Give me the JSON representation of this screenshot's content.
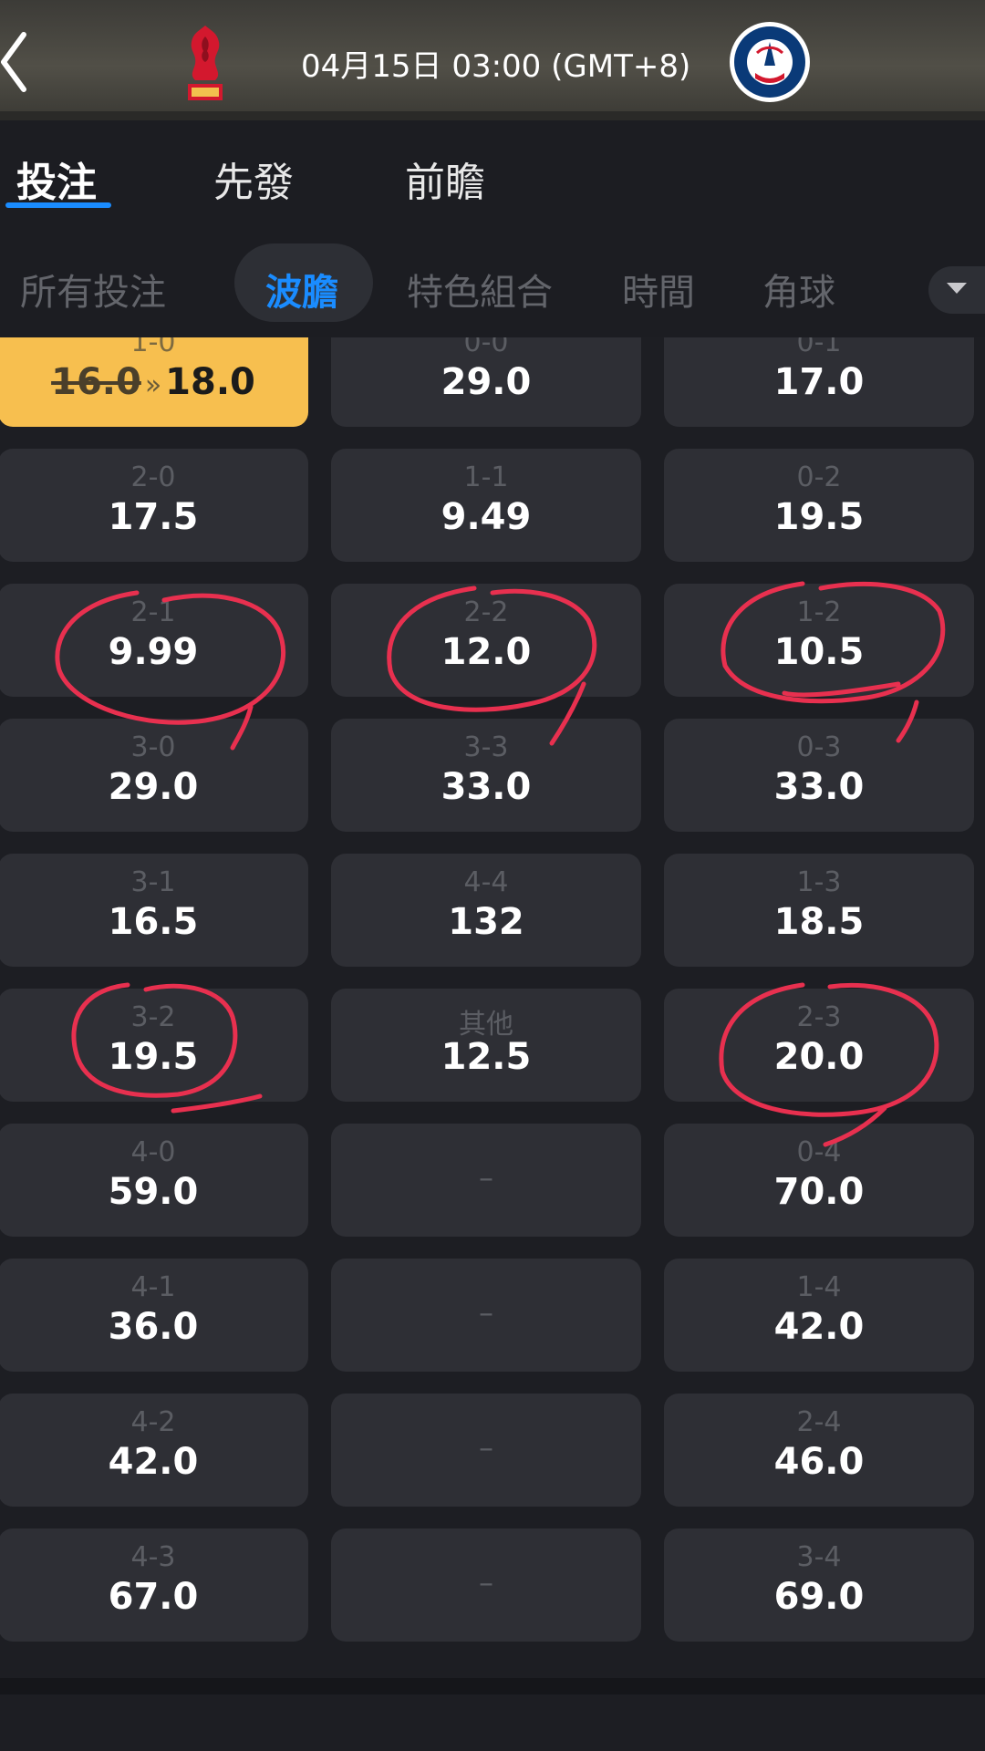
{
  "header": {
    "back_icon": "chevron-left-icon",
    "home_logo": "liverpool-crest",
    "away_logo": "psg-crest",
    "match_time": "04月15日 03:00 (GMT+8)"
  },
  "tabs": [
    {
      "label": "投注",
      "active": true
    },
    {
      "label": "先發",
      "active": false
    },
    {
      "label": "前瞻",
      "active": false
    }
  ],
  "subtabs": [
    {
      "label": "所有投注",
      "active": false
    },
    {
      "label": "波膽",
      "active": true
    },
    {
      "label": "特色組合",
      "active": false
    },
    {
      "label": "時間",
      "active": false
    },
    {
      "label": "角球",
      "active": false
    }
  ],
  "more_icon": "triangle-down-icon",
  "colors": {
    "accent": "#1a8cff",
    "highlight": "#f7bf4f",
    "cell": "#2e2f35",
    "annotation": "#e8304f"
  },
  "odds": {
    "highlighted": {
      "score": "1-0",
      "old_odds": "16.0",
      "arrow": "»",
      "new_odds": "18.0"
    },
    "rows": [
      [
        {
          "score": "2-0",
          "odds": "17.5"
        },
        {
          "score": "1-1",
          "odds": "9.49"
        },
        {
          "score": "0-2",
          "odds": "19.5"
        }
      ],
      [
        {
          "score": "2-1",
          "odds": "9.99"
        },
        {
          "score": "2-2",
          "odds": "12.0"
        },
        {
          "score": "1-2",
          "odds": "10.5"
        }
      ],
      [
        {
          "score": "3-0",
          "odds": "29.0"
        },
        {
          "score": "3-3",
          "odds": "33.0"
        },
        {
          "score": "0-3",
          "odds": "33.0"
        }
      ],
      [
        {
          "score": "3-1",
          "odds": "16.5"
        },
        {
          "score": "4-4",
          "odds": "132"
        },
        {
          "score": "1-3",
          "odds": "18.5"
        }
      ],
      [
        {
          "score": "3-2",
          "odds": "19.5"
        },
        {
          "score": "其他",
          "odds": "12.5"
        },
        {
          "score": "2-3",
          "odds": "20.0"
        }
      ],
      [
        {
          "score": "4-0",
          "odds": "59.0"
        },
        {
          "dash": "–"
        },
        {
          "score": "0-4",
          "odds": "70.0"
        }
      ],
      [
        {
          "score": "4-1",
          "odds": "36.0"
        },
        {
          "dash": "–"
        },
        {
          "score": "1-4",
          "odds": "42.0"
        }
      ],
      [
        {
          "score": "4-2",
          "odds": "42.0"
        },
        {
          "dash": "–"
        },
        {
          "score": "2-4",
          "odds": "46.0"
        }
      ],
      [
        {
          "score": "4-3",
          "odds": "67.0"
        },
        {
          "dash": "–"
        },
        {
          "score": "3-4",
          "odds": "69.0"
        }
      ]
    ],
    "first_row_others": [
      {
        "score": "0-0",
        "odds": "29.0"
      },
      {
        "score": "0-1",
        "odds": "17.0"
      }
    ]
  }
}
